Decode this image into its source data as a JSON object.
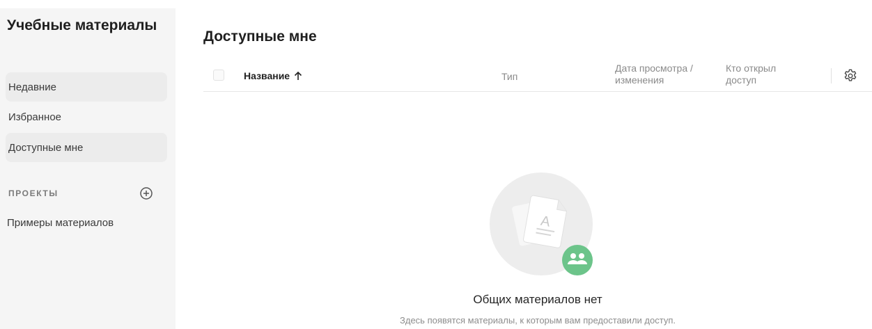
{
  "sidebar": {
    "title": "Учебные материалы",
    "items": [
      {
        "label": "Недавние"
      },
      {
        "label": "Избранное"
      },
      {
        "label": "Доступные мне"
      }
    ],
    "projects_label": "ПРОЕКТЫ",
    "projects": [
      {
        "label": "Примеры материалов"
      }
    ]
  },
  "main": {
    "title": "Доступные мне",
    "table": {
      "columns": {
        "name": "Название",
        "type": "Тип",
        "date_line1": "Дата просмотра /",
        "date_line2": "изменения",
        "owner_line1": "Кто открыл",
        "owner_line2": "доступ"
      },
      "sort": {
        "column": "name",
        "direction": "ascending"
      }
    },
    "empty": {
      "title": "Общих материалов нет",
      "subtitle": "Здесь появятся материалы, к которым вам предоставили доступ."
    }
  },
  "colors": {
    "sidebar_bg": "#f5f5f5",
    "badge_green": "#6cc48a",
    "illustration_circle": "#ededed"
  },
  "icons": {
    "add_project": "plus-circle-icon",
    "sort": "arrow-up-icon",
    "settings": "gear-icon",
    "badge": "people-icon",
    "document": "document-icon"
  }
}
